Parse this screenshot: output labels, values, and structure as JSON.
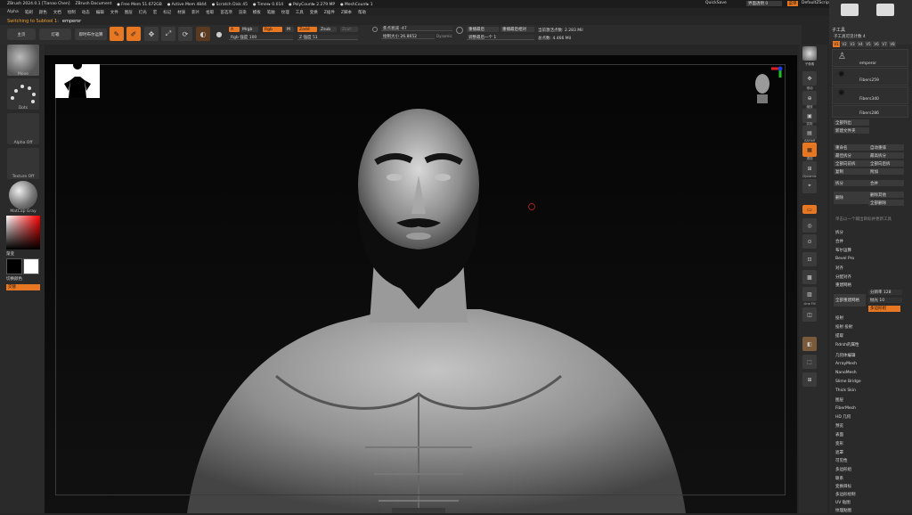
{
  "titlebar": {
    "items": [
      "ZBrush 2024.0.1 [Tianao Chen]",
      "ZBrush Document",
      "Free Mem 51.672GB",
      "Active Mem 4844",
      "Scratch Disk 45",
      "Timer▸ 0.014",
      "PolyCount▸ 2.279 MP",
      "MeshCount▸ 1"
    ],
    "quicksave": "QuickSave",
    "transparency": "界面透明 0",
    "menu_btn": "菜单",
    "script": "DefaultZScript"
  },
  "menubar": [
    "Alpha",
    "笔刷",
    "颜色",
    "文档",
    "绘制",
    "动态",
    "编辑",
    "文件",
    "图层",
    "灯光",
    "宏",
    "标记",
    "材质",
    "影片",
    "拾取",
    "首选项",
    "渲染",
    "模板",
    "笔触",
    "纹理",
    "工具",
    "变换",
    "Z插件",
    "Z脚本",
    "帮助"
  ],
  "subbar": {
    "label": "Switching to Subtool 1:",
    "value": "emperor"
  },
  "toolbar": {
    "home": "主页",
    "lightbox": "灯箱",
    "live_boolean": "即时布尔运算",
    "edit": "Edit",
    "draw": "Draw",
    "move": "Move",
    "scale": "Scale",
    "rotate": "Rotate",
    "a": "A",
    "mrgb": "Mrgb",
    "rgb": "Rgb",
    "m": "M",
    "rgb_intensity": "Rgb 强度 100",
    "zadd": "Zadd",
    "zsub": "Zsub",
    "zcut": "Zcut",
    "z_intensity": "Z 强度 51",
    "focal_shift": "焦点衰减 -47",
    "draw_size": "绘制大小 26.8652",
    "dynamic": "Dynamic",
    "replay_last": "重播最后",
    "replay_last_rel": "重播最后相对",
    "adjust_last": "调整最后一个 1",
    "active_points": "当前激活点数: 2.283 Mil",
    "total_points": "总点数: 4.466 Mil"
  },
  "leftshelf": {
    "brush": "Move",
    "stroke": "Dots",
    "alpha": "Alpha Off",
    "texture": "Texture Off",
    "material": "MatCap Gray",
    "gradient": "渐变",
    "switch_color": "切换颜色",
    "alternate": "交替"
  },
  "rightshelf": {
    "items": [
      "子像素",
      "滚动",
      "缩放",
      "实际",
      "AAHalf",
      "透视",
      "楼层",
      "局部",
      "",
      "Dynamic",
      "Transp",
      "Ghost",
      "Solo",
      "",
      "多边形框",
      "",
      "Line Fill",
      "PolyF",
      "",
      "透明",
      "",
      ""
    ]
  },
  "rpanel": {
    "header": "子工具",
    "subtool_count": "子工具可见计数 4",
    "tabs": [
      "V1",
      "V2",
      "V3",
      "V4",
      "V5",
      "V6",
      "V7",
      "V8"
    ],
    "subtools": [
      "emperor",
      "Fibers259",
      "Fibers340",
      "Fibers286"
    ],
    "list_all": "全部列出",
    "new_folder": "新建文件夹",
    "btn_pairs": [
      [
        "重命名",
        "自动重排"
      ],
      [
        "最佳拆分",
        "最高拆分"
      ],
      [
        "全部向前拆",
        "全部向后拆"
      ],
      [
        "复制",
        "附加"
      ],
      [
        "",
        ""
      ],
      [
        "拆分",
        "合并"
      ]
    ],
    "split_delete": "删除",
    "delete_others": "删除其他",
    "delete_all": "全部删除",
    "hint": "单击以一个输出目标并更新工具",
    "sections1": [
      "拆分",
      "合并",
      "布尔运算",
      "Bevel Pro",
      "对齐",
      "分配对齐",
      "重建网格"
    ],
    "remesh_all": "全部重建网格",
    "resolution": "分辨率 128",
    "polish": "抛光 10",
    "multi_shape": "多边形组",
    "sections2": [
      "投射",
      "投射 投射",
      "提取",
      "Rdrsh的属性"
    ],
    "geometry_list": [
      "几何体编辑",
      "ArrayMesh",
      "NanoMesh",
      "Slime Bridge",
      "Thick Skin",
      "图层",
      "FiberMesh",
      "HD 几何",
      "预览",
      "表面",
      "变形",
      "遮罩",
      "可见性",
      "多边形组",
      "联系",
      "变换目标",
      "多边形绘制",
      "UV 贴图",
      "纹理贴图"
    ]
  },
  "brand_accent": "#e87722"
}
